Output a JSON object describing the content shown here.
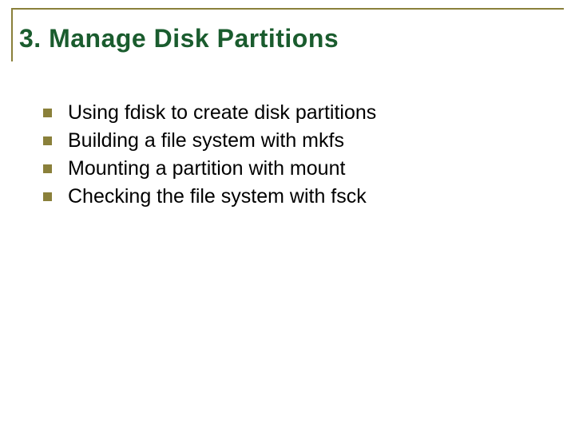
{
  "title": "3.  Manage Disk Partitions",
  "bullets": [
    "Using fdisk to create disk partitions",
    "Building a file system with mkfs",
    "Mounting a partition with mount",
    "Checking the file system with fsck"
  ]
}
